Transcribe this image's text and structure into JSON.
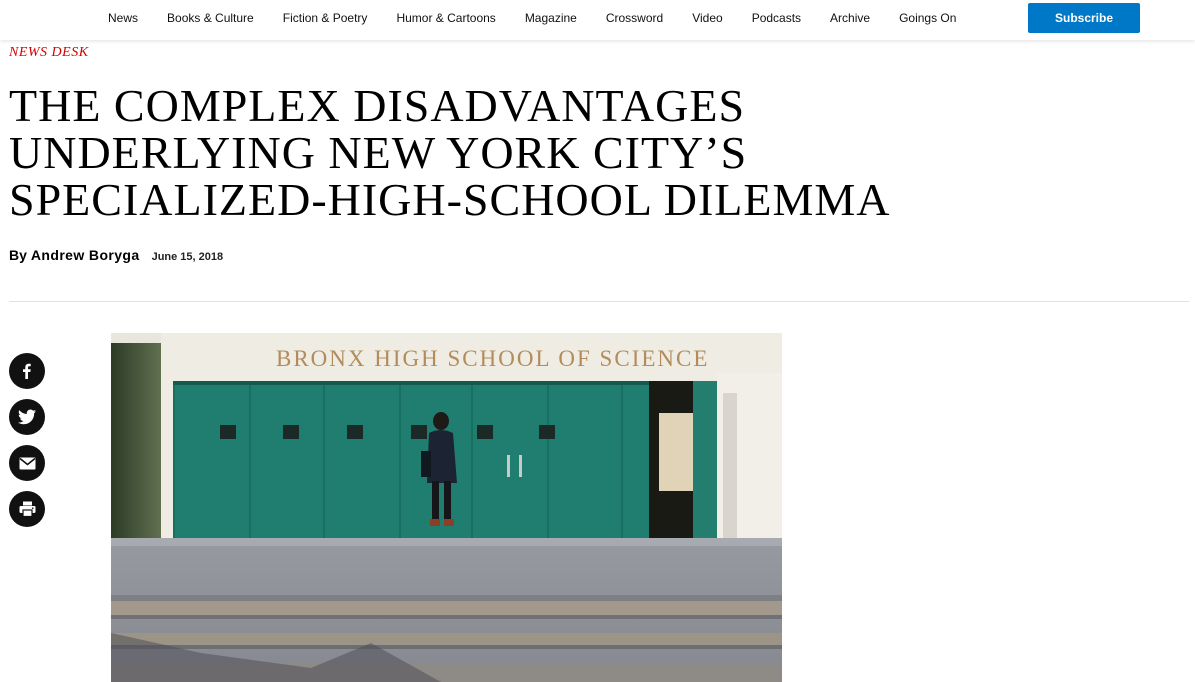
{
  "nav": {
    "items": [
      {
        "label": "News"
      },
      {
        "label": "Books & Culture"
      },
      {
        "label": "Fiction & Poetry"
      },
      {
        "label": "Humor & Cartoons"
      },
      {
        "label": "Magazine"
      },
      {
        "label": "Crossword"
      },
      {
        "label": "Video"
      },
      {
        "label": "Podcasts"
      },
      {
        "label": "Archive"
      },
      {
        "label": "Goings On"
      }
    ],
    "subscribe_label": "Subscribe"
  },
  "article": {
    "rubric": "News Desk",
    "headline": "The Complex Disadvantages Underlying New York City’s Specialized-High-School Dilemma",
    "byline_prefix": "By",
    "author": "Andrew Boryga",
    "date": "June 15, 2018"
  },
  "share": {
    "icons": [
      "facebook-icon",
      "twitter-icon",
      "email-icon",
      "print-icon"
    ]
  },
  "photo": {
    "sign_text": "BRONX HIGH SCHOOL OF SCIENCE"
  },
  "colors": {
    "accent_red": "#d40000",
    "subscribe_blue": "#0078c8",
    "door_green": "#1f7e6f"
  }
}
